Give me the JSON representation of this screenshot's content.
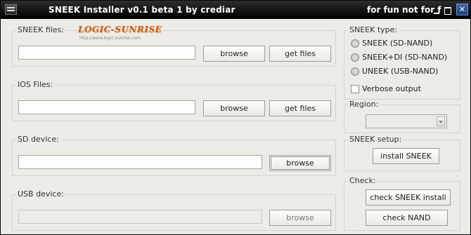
{
  "window": {
    "title": "SNEEK Installer v0.1 beta 1 by crediar",
    "title_tail": "for fun not for f"
  },
  "logo": {
    "main": "LOGIC-SUNRISE",
    "sub": "http://www.logic-sunrise.com"
  },
  "sneek_files": {
    "label": "SNEEK files:",
    "value": "",
    "browse_label": "browse",
    "get_files_label": "get files"
  },
  "ios_files": {
    "label": "IOS Files:",
    "value": "",
    "browse_label": "browse",
    "get_files_label": "get files"
  },
  "sd_device": {
    "label": "SD device:",
    "value": "",
    "browse_label": "browse"
  },
  "usb_device": {
    "label": "USB device:",
    "value": "",
    "browse_label": "browse"
  },
  "sneek_type": {
    "label": "SNEEK type:",
    "options": [
      "SNEEK (SD-NAND)",
      "SNEEK+DI (SD-NAND)",
      "UNEEK (USB-NAND)"
    ],
    "verbose_label": "Verbose output"
  },
  "region": {
    "label": "Region:",
    "selected": ""
  },
  "sneek_setup": {
    "label": "SNEEK setup:",
    "install_label": "install SNEEK"
  },
  "check": {
    "label": "Check:",
    "check_install_label": "check SNEEK install",
    "check_nand_label": "check NAND"
  }
}
